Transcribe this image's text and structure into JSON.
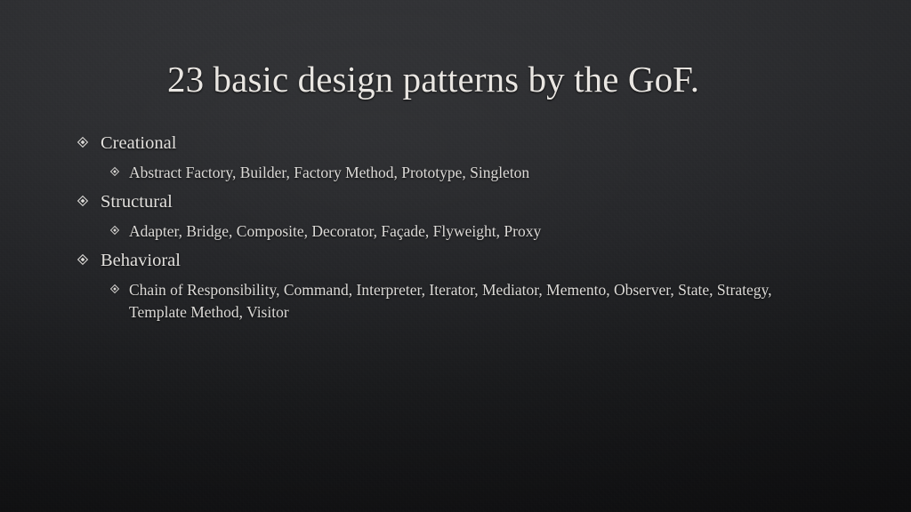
{
  "slide": {
    "title": "23 basic design patterns by the GoF.",
    "background_color": "#232427",
    "title_color": "#e9e6e2",
    "body_color": "#dcdad7",
    "bullet_glyph_level1": "diamond-bullet-icon",
    "bullet_glyph_level2": "diamond-bullet-icon",
    "groups": [
      {
        "category": "Creational",
        "patterns": "Abstract Factory, Builder, Factory Method, Prototype, Singleton"
      },
      {
        "category": "Structural",
        "patterns": "Adapter, Bridge, Composite, Decorator, Façade, Flyweight, Proxy"
      },
      {
        "category": "Behavioral",
        "patterns": "Chain of Responsibility, Command, Interpreter, Iterator, Mediator, Memento, Observer, State, Strategy, Template Method, Visitor"
      }
    ]
  }
}
